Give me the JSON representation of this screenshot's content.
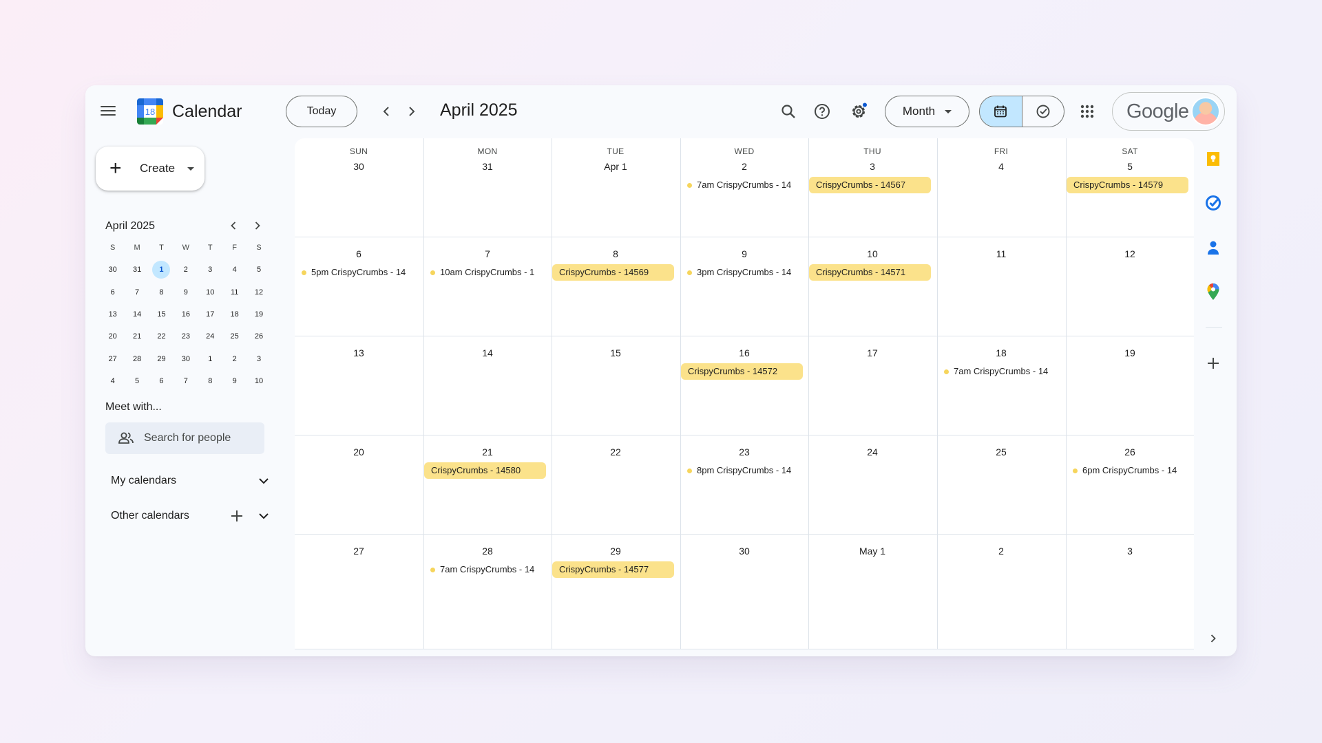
{
  "header": {
    "menu_icon": "hamburger-icon",
    "logo_text": "18",
    "app_title": "Calendar",
    "today_label": "Today",
    "current_month": "April 2025",
    "view_select": "Month",
    "account_brand": "Google"
  },
  "sidebar": {
    "create_label": "Create",
    "mini_calendar": {
      "title": "April 2025",
      "weekdays": [
        "S",
        "M",
        "T",
        "W",
        "T",
        "F",
        "S"
      ],
      "weeks": [
        [
          "30",
          "31",
          "1",
          "2",
          "3",
          "4",
          "5"
        ],
        [
          "6",
          "7",
          "8",
          "9",
          "10",
          "11",
          "12"
        ],
        [
          "13",
          "14",
          "15",
          "16",
          "17",
          "18",
          "19"
        ],
        [
          "20",
          "21",
          "22",
          "23",
          "24",
          "25",
          "26"
        ],
        [
          "27",
          "28",
          "29",
          "30",
          "1",
          "2",
          "3"
        ],
        [
          "4",
          "5",
          "6",
          "7",
          "8",
          "9",
          "10"
        ]
      ],
      "today": "1"
    },
    "meet_title": "Meet with...",
    "search_placeholder": "Search for people",
    "my_calendars": "My calendars",
    "other_calendars": "Other calendars"
  },
  "month_view": {
    "weekdays": [
      "SUN",
      "MON",
      "TUE",
      "WED",
      "THU",
      "FRI",
      "SAT"
    ],
    "weeks": [
      [
        "30",
        "31",
        "Apr 1",
        "2",
        "3",
        "4",
        "5"
      ],
      [
        "6",
        "7",
        "8",
        "9",
        "10",
        "11",
        "12"
      ],
      [
        "13",
        "14",
        "15",
        "16",
        "17",
        "18",
        "19"
      ],
      [
        "20",
        "21",
        "22",
        "23",
        "24",
        "25",
        "26"
      ],
      [
        "27",
        "28",
        "29",
        "30",
        "May 1",
        "2",
        "3"
      ]
    ],
    "events": [
      {
        "week": 0,
        "day": 3,
        "kind": "timed",
        "time": "7am",
        "title": "CrispyCrumbs - 14",
        "color": "#f6d55c"
      },
      {
        "week": 0,
        "day": 4,
        "kind": "allday",
        "title": "CrispyCrumbs - 14567",
        "color": "#fbe28b"
      },
      {
        "week": 0,
        "day": 6,
        "kind": "allday",
        "title": "CrispyCrumbs - 14579",
        "color": "#fbe28b"
      },
      {
        "week": 1,
        "day": 0,
        "kind": "timed",
        "time": "5pm",
        "title": "CrispyCrumbs - 14",
        "color": "#f6d55c"
      },
      {
        "week": 1,
        "day": 1,
        "kind": "timed",
        "time": "10am",
        "title": "CrispyCrumbs - 1",
        "color": "#f6d55c"
      },
      {
        "week": 1,
        "day": 2,
        "kind": "allday",
        "title": "CrispyCrumbs - 14569",
        "color": "#fbe28b"
      },
      {
        "week": 1,
        "day": 3,
        "kind": "timed",
        "time": "3pm",
        "title": "CrispyCrumbs - 14",
        "color": "#f6d55c"
      },
      {
        "week": 1,
        "day": 4,
        "kind": "allday",
        "title": "CrispyCrumbs - 14571",
        "color": "#fbe28b"
      },
      {
        "week": 2,
        "day": 3,
        "kind": "allday",
        "title": "CrispyCrumbs - 14572",
        "color": "#fbe28b"
      },
      {
        "week": 2,
        "day": 5,
        "kind": "timed",
        "time": "7am",
        "title": "CrispyCrumbs - 14",
        "color": "#f6d55c"
      },
      {
        "week": 3,
        "day": 1,
        "kind": "allday",
        "title": "CrispyCrumbs - 14580",
        "color": "#fbe28b"
      },
      {
        "week": 3,
        "day": 3,
        "kind": "timed",
        "time": "8pm",
        "title": "CrispyCrumbs - 14",
        "color": "#f6d55c"
      },
      {
        "week": 3,
        "day": 6,
        "kind": "timed",
        "time": "6pm",
        "title": "CrispyCrumbs - 14",
        "color": "#f6d55c"
      },
      {
        "week": 4,
        "day": 1,
        "kind": "timed",
        "time": "7am",
        "title": "CrispyCrumbs - 14",
        "color": "#f6d55c"
      },
      {
        "week": 4,
        "day": 2,
        "kind": "allday",
        "title": "CrispyCrumbs - 14577",
        "color": "#fbe28b"
      }
    ]
  },
  "side_panel": {
    "icons": [
      "keep-icon",
      "tasks-icon",
      "contacts-icon",
      "maps-icon",
      "add-icon",
      "chevron-right-icon"
    ]
  },
  "colors": {
    "accent": "#0b57d0",
    "selected_bg": "#c2e7ff",
    "event_chip": "#fbe28b"
  }
}
